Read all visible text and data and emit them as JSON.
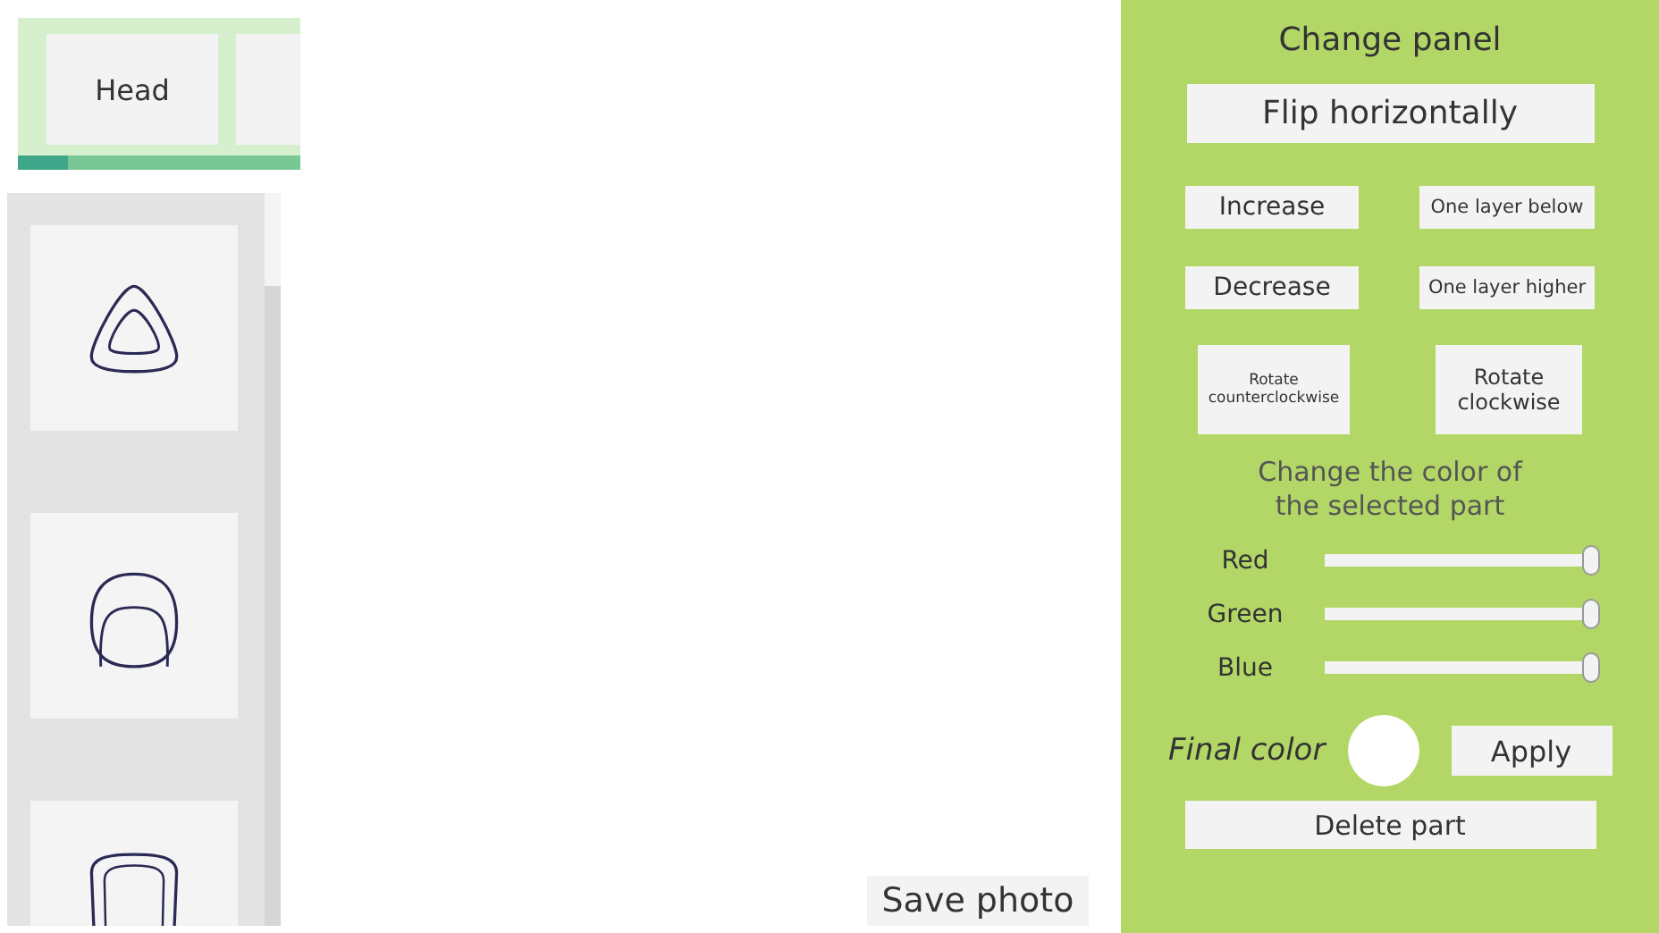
{
  "tabs": [
    {
      "label": "Head",
      "selected": true
    },
    {
      "selected": false
    }
  ],
  "parts": [
    {
      "kind": "triangle"
    },
    {
      "kind": "round"
    },
    {
      "kind": "tall"
    }
  ],
  "save_button": "Save photo",
  "panel": {
    "title": "Change panel",
    "flip_button": "Flip horizontally",
    "buttons": [
      {
        "label": "Increase",
        "kind": "large"
      },
      {
        "label": "One layer below",
        "kind": "small"
      },
      {
        "label": "Decrease",
        "kind": "large"
      },
      {
        "label": "One layer higher",
        "kind": "small"
      }
    ],
    "rotate_buttons": [
      {
        "label": "Rotate counterclockwise",
        "kind": "tiny"
      },
      {
        "label": "Rotate clockwise",
        "kind": "medium"
      }
    ],
    "color_heading": "Change the color of the selected part",
    "sliders": [
      {
        "label": "Red",
        "level": 1
      },
      {
        "label": "Green",
        "level": 1
      },
      {
        "label": "Blue",
        "level": 1
      }
    ],
    "final_color_label": "Final color",
    "apply_button": "Apply",
    "delete_button": "Delete part"
  }
}
